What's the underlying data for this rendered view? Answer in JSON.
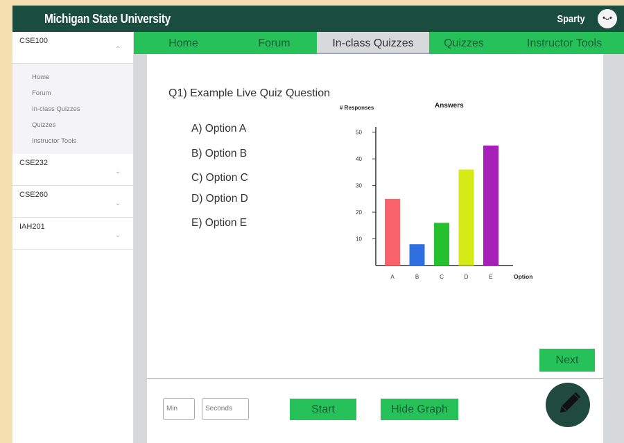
{
  "header": {
    "brand": "Michigan State University",
    "user": "Sparty",
    "avatar_face": "•ᴗ•"
  },
  "sidebar": {
    "courses": [
      {
        "name": "CSE100",
        "expanded": true,
        "chevron": "⌃"
      },
      {
        "name": "CSE232",
        "expanded": false,
        "chevron": "⌄"
      },
      {
        "name": "CSE260",
        "expanded": false,
        "chevron": "⌄"
      },
      {
        "name": "IAH201",
        "expanded": false,
        "chevron": "⌄"
      }
    ],
    "subitems": [
      "Home",
      "Forum",
      "In-class Quizzes",
      "Quizzes",
      "Instructor Tools"
    ]
  },
  "tabs": [
    "Home",
    "Forum",
    "In-class Quizzes",
    "Quizzes",
    "Instructor Tools"
  ],
  "active_tab": "In-class Quizzes",
  "quiz": {
    "question": "Q1) Example Live Quiz Question",
    "options": [
      "A) Option A",
      "B) Option B",
      "C) Option C",
      "D) Option D",
      "E) Option E"
    ]
  },
  "chart_data": {
    "type": "bar",
    "title": "Answers",
    "ylabel": "# Responses",
    "xlabel": "Option",
    "categories": [
      "A",
      "B",
      "C",
      "D",
      "E"
    ],
    "values": [
      25,
      8,
      16,
      36,
      45
    ],
    "colors": [
      "#f8636b",
      "#2e6fe0",
      "#25c12e",
      "#d6ea17",
      "#a51fb8"
    ],
    "yticks": [
      10,
      20,
      30,
      40,
      50
    ],
    "ylim": [
      0,
      52
    ]
  },
  "controls": {
    "min_placeholder": "Min",
    "seconds_placeholder": "Seconds",
    "start": "Start",
    "hide_graph": "Hide Graph",
    "next": "Next",
    "edit_icon": "pencil-icon"
  },
  "colors": {
    "header": "#1a4d3e",
    "accent": "#27c15a",
    "fab": "#1f4a3d"
  }
}
